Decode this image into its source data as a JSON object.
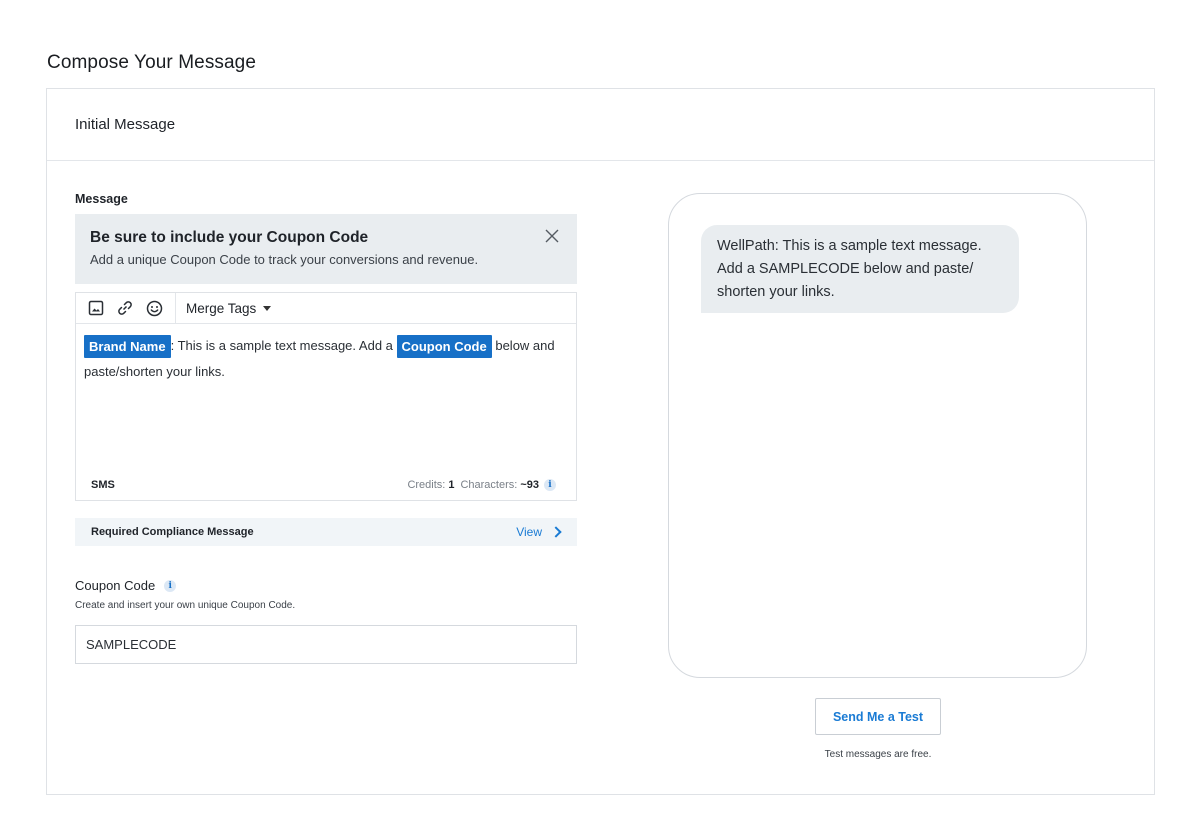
{
  "page": {
    "title": "Compose Your Message"
  },
  "card": {
    "header": "Initial Message"
  },
  "message": {
    "label": "Message",
    "notice": {
      "title": "Be sure to include your Coupon Code",
      "subtitle": "Add a unique Coupon Code to track your conversions and revenue."
    },
    "toolbar": {
      "icons": [
        "image-icon",
        "link-icon",
        "emoji-icon"
      ],
      "merge_tags_label": "Merge Tags"
    },
    "body": {
      "tag_brand": "Brand Name",
      "text_1": ": This is a sample text message. Add a ",
      "tag_coupon": "Coupon Code",
      "text_2": " below and paste/shorten your links."
    },
    "footer": {
      "type": "SMS",
      "credits_label": "Credits:",
      "credits_value": "1",
      "characters_label": "Characters:",
      "characters_value": "~93"
    }
  },
  "compliance": {
    "label": "Required Compliance Message",
    "view_label": "View"
  },
  "coupon": {
    "label": "Coupon Code",
    "subtitle": "Create and insert your own unique Coupon Code.",
    "value": "SAMPLECODE"
  },
  "preview": {
    "bubble_text": "WellPath: This is a sample text message. Add a SAMPLECODE below and paste/ shorten your links."
  },
  "test": {
    "button_label": "Send Me a Test",
    "note": "Test messages are free."
  },
  "colors": {
    "accent": "#1770c7",
    "link": "#1a7bd4",
    "notice_bg": "#e9edf0"
  }
}
